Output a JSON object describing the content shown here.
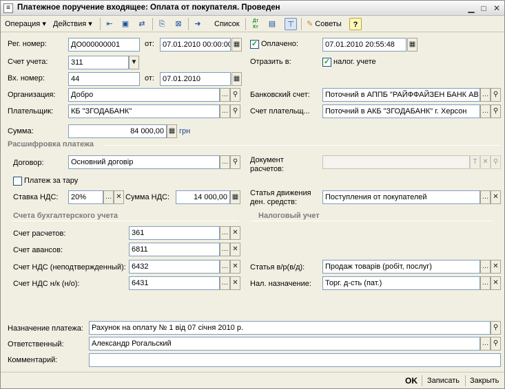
{
  "window": {
    "title": "Платежное поручение входящее: Оплата от покупателя. Проведен",
    "app_icon": "document-icon",
    "controls": [
      "minimize-icon",
      "maximize-icon",
      "close-icon"
    ]
  },
  "toolbar": {
    "operation_label": "Операция",
    "actions_label": "Действия",
    "list_label": "Список",
    "tips_label": "Советы",
    "help_icon": "?",
    "dt_kt": "Дт Кт"
  },
  "form": {
    "reg_number": {
      "label": "Рег. номер:",
      "value": "ДО000000001",
      "from_label": "от:",
      "date": "07.01.2010 00:00:00"
    },
    "paid": {
      "label": "Оплачено:",
      "checked": true,
      "date": "07.01.2010 20:55:48"
    },
    "account": {
      "label": "Счет учета:",
      "value": "311"
    },
    "reflect": {
      "label": "Отразить в:",
      "checkbox_label": "налог. учете",
      "checked": true
    },
    "incoming_number": {
      "label": "Вх. номер:",
      "value": "44",
      "from_label": "от:",
      "date": "07.01.2010"
    },
    "organization": {
      "label": "Организация:",
      "value": "Добро"
    },
    "bank_account": {
      "label": "Банковский счет:",
      "value": "Поточний в АППБ \"РАЙФФАЙЗЕН БАНК АВ"
    },
    "payer": {
      "label": "Плательщик:",
      "value": "КБ \"ЗГОДАБАНК\""
    },
    "payer_account": {
      "label": "Счет плательщ...",
      "value": "Поточний в АКБ \"ЗГОДАБАНК\" г. Херсон"
    },
    "amount": {
      "label": "Сумма:",
      "value": "84 000,00",
      "currency": "грн"
    }
  },
  "breakdown": {
    "section_title": "Расшифровка платежа",
    "contract": {
      "label": "Договор:",
      "value": "Основний договір"
    },
    "settlement_doc": {
      "label_line1": "Документ",
      "label_line2": "расчетов:",
      "value": ""
    },
    "container_payment": {
      "label": "Платеж за тару",
      "checked": false
    },
    "vat_rate": {
      "label": "Ставка НДС:",
      "value": "20%"
    },
    "vat_amount": {
      "label": "Сумма НДС:",
      "value": "14 000,00"
    },
    "cash_flow": {
      "label_line1": "Статья движения",
      "label_line2": "ден. средств:",
      "value": "Поступления от покупателей"
    }
  },
  "accounting": {
    "section_title": "Счета бухгалтерского учета",
    "settlement_account": {
      "label": "Счет расчетов:",
      "value": "361"
    },
    "advance_account": {
      "label": "Счет авансов:",
      "value": "6811"
    },
    "vat_unconfirmed": {
      "label": "Счет НДС (неподтвержденный):",
      "value": "6432"
    },
    "vat_nk": {
      "label": "Счет НДС н/к (н/о):",
      "value": "6431"
    }
  },
  "tax": {
    "section_title": "Налоговый учет",
    "income_item": {
      "label": "Статья в/р(в/д):",
      "value": "Продаж товарів (робіт, послуг)"
    },
    "tax_purpose": {
      "label": "Нал. назначение:",
      "value": "Торг. д-сть (пат.)"
    }
  },
  "bottom": {
    "payment_purpose": {
      "label": "Назначение платежа:",
      "value": "Рахунок на оплату № 1 від 07 січня 2010 р."
    },
    "responsible": {
      "label": "Ответственный:",
      "value": "Александр Рогальский"
    },
    "comment": {
      "label": "Комментарий:",
      "value": ""
    }
  },
  "statusbar": {
    "ok_label": "OK",
    "save_label": "Записать",
    "close_label": "Закрыть"
  }
}
